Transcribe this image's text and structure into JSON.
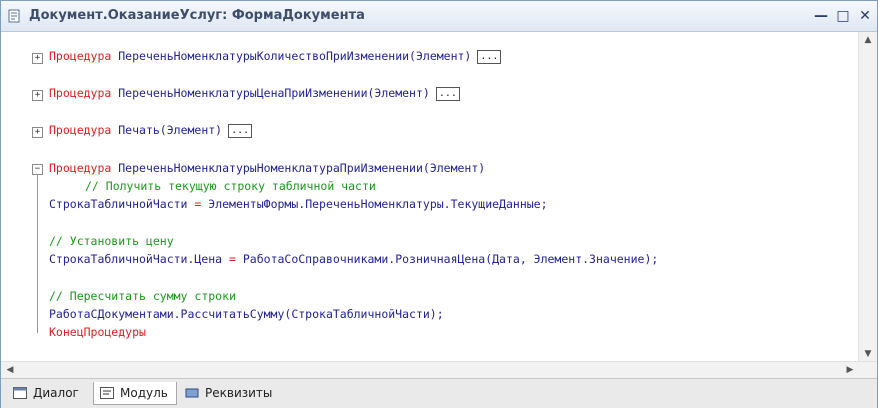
{
  "window": {
    "title": "Документ.ОказаниеУслуг: ФормаДокумента",
    "controls": {
      "minimize": "—",
      "maximize": "□",
      "close": "✕"
    }
  },
  "code": {
    "line1": {
      "keyword": "Процедура",
      "name": "ПереченьНоменклатурыКоличествоПриИзменении",
      "args": "(Элемент)",
      "fold": "+",
      "ellipsis": "..."
    },
    "line2": {
      "keyword": "Процедура",
      "name": "ПереченьНоменклатурыЦенаПриИзменении",
      "args": "(Элемент)",
      "fold": "+",
      "ellipsis": "..."
    },
    "line3": {
      "keyword": "Процедура",
      "name": "Печать",
      "args": "(Элемент)",
      "fold": "+",
      "ellipsis": "..."
    },
    "line4": {
      "keyword": "Процедура",
      "name": "ПереченьНоменклатурыНоменклатураПриИзменении",
      "args": "(Элемент)",
      "fold": "−"
    },
    "comment1": "// Получить текущую строку табличной части",
    "stmt1_lhs": "СтрокаТабличнойЧасти",
    "stmt1_op": " = ",
    "stmt1_rhs": "ЭлементыФормы.ПереченьНоменклатуры.ТекущиеДанные;",
    "comment2": "// Установить цену",
    "stmt2_lhs": "СтрокаТабличнойЧасти.Цена",
    "stmt2_op": " = ",
    "stmt2_rhs": "РаботаСоСправочниками.РозничнаяЦена(Дата, Элемент.Значение);",
    "comment3": "// Пересчитать сумму строки",
    "stmt3": "РаботаСДокументами.РассчитатьСумму(СтрокаТабличнойЧасти);",
    "end": "КонецПроцедуры"
  },
  "tabs": [
    {
      "label": "Диалог",
      "icon": "dialog-icon"
    },
    {
      "label": "Модуль",
      "icon": "module-icon",
      "active": true
    },
    {
      "label": "Реквизиты",
      "icon": "attributes-icon"
    }
  ],
  "colors": {
    "keyword": "#e0201e",
    "identifier": "#23239a",
    "comment": "#1a9a1a"
  }
}
